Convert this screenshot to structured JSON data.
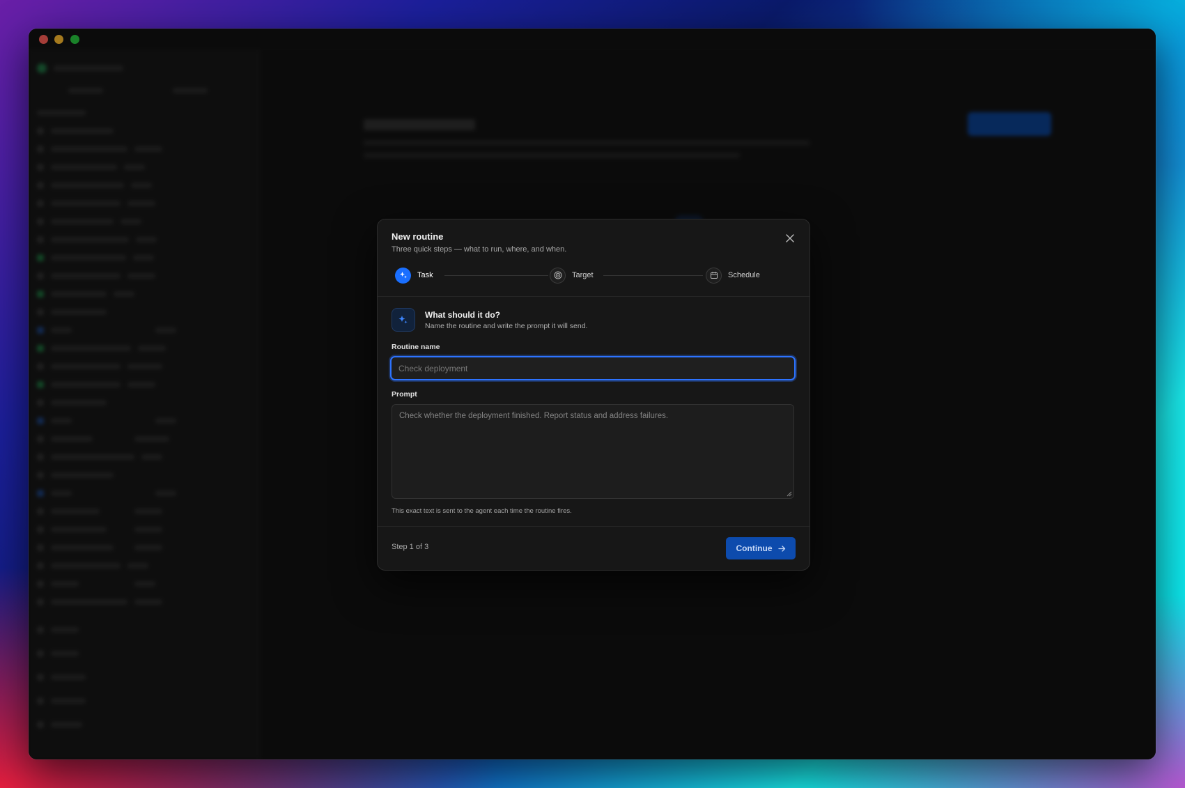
{
  "modal": {
    "title": "New routine",
    "subtitle": "Three quick steps — what to run, where, and when.",
    "steps": [
      {
        "label": "Task",
        "icon": "sparkle-icon",
        "active": true
      },
      {
        "label": "Target",
        "icon": "target-icon",
        "active": false
      },
      {
        "label": "Schedule",
        "icon": "calendar-icon",
        "active": false
      }
    ],
    "section": {
      "title": "What should it do?",
      "subtitle": "Name the routine and write the prompt it will send."
    },
    "routine_name": {
      "label": "Routine name",
      "value": "",
      "placeholder": "Check deployment"
    },
    "prompt": {
      "label": "Prompt",
      "value": "",
      "placeholder": "Check whether the deployment finished. Report status and address failures."
    },
    "hint": "This exact text is sent to the agent each time the routine fires.",
    "footer": {
      "step_indicator": "Step 1 of 3",
      "continue_label": "Continue"
    }
  },
  "colors": {
    "accent": "#1a6fff",
    "button": "#0d4bad",
    "modal_bg": "#171717"
  }
}
